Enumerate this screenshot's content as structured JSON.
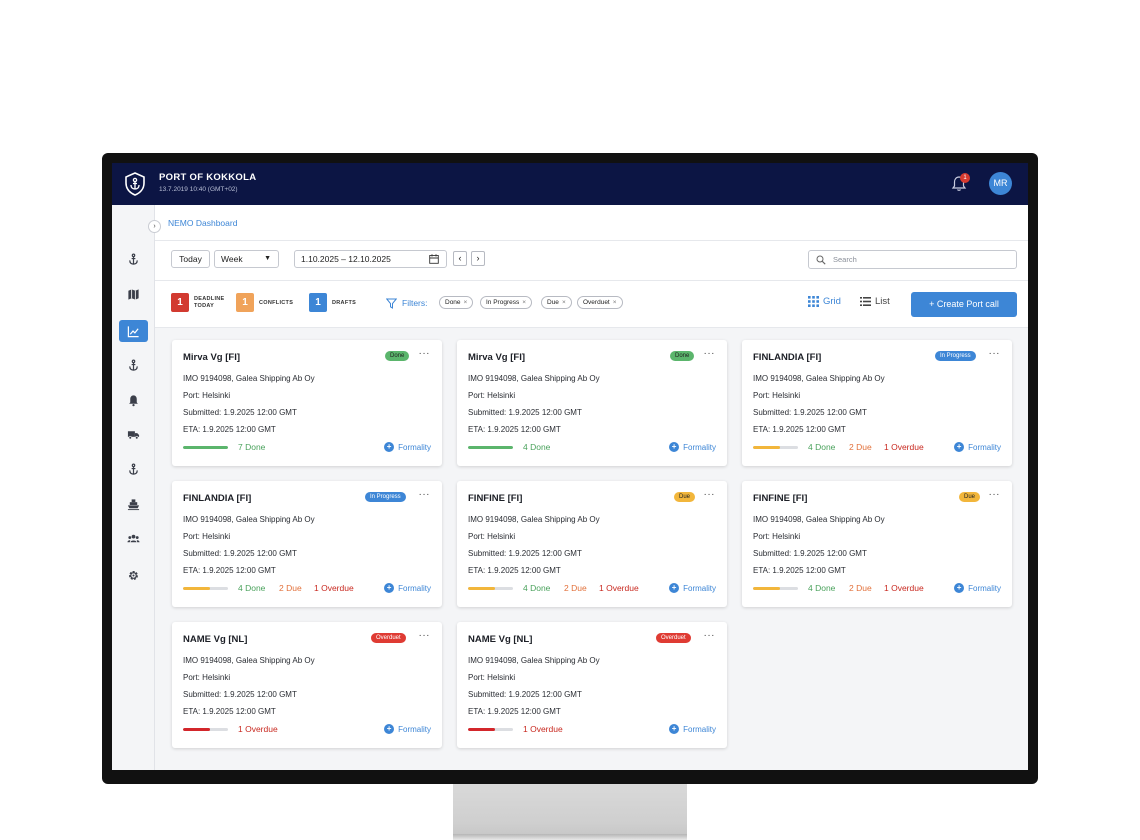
{
  "header": {
    "title": "PORT OF KOKKOLA",
    "datetime": "13.7.2019 10:40 (GMT+02)",
    "notifications": "1",
    "avatar_initials": "MR"
  },
  "breadcrumb": "NEMO Dashboard",
  "toolbar": {
    "today_label": "Today",
    "period_value": "Week",
    "date_range": "1.10.2025  –  12.10.2025",
    "search_placeholder": "Search"
  },
  "status": {
    "deadline_count": "1",
    "deadline_label_1": "DEADLINE",
    "deadline_label_2": "TODAY",
    "conflicts_count": "1",
    "conflicts_label": "CONFLICTS",
    "drafts_count": "1",
    "drafts_label": "DRAFTS",
    "filters_label": "Filters:",
    "filters": [
      "Done",
      "In Progress",
      "Due",
      "Overduet"
    ],
    "view_grid": "Grid",
    "view_list": "List",
    "create_label": "+  Create Port call"
  },
  "colors": {
    "accent": "#3d86d6",
    "topbar": "#0c1544",
    "done": "#5bb56c",
    "due": "#f2b63b",
    "overdue": "#df3b33",
    "deadline": "#d23a30",
    "conflicts": "#f0a35a"
  },
  "cards": [
    {
      "title": "Mirva Vg [FI]",
      "status": "Done",
      "imo": "IMO 9194098,  Galea Shipping Ab Oy",
      "port": "Port:  Helsinki",
      "submitted": "Submitted: 1.9.2025 12:00 GMT",
      "eta": "ETA: 1.9.2025 12:00 GMT",
      "done": "7 Done",
      "due": "",
      "overdue": "",
      "progress": 1.0,
      "progress_color": "#5bb56c",
      "formality": "Formality"
    },
    {
      "title": "Mirva Vg [FI]",
      "status": "Done",
      "imo": "IMO 9194098,  Galea Shipping Ab Oy",
      "port": "Port:  Helsinki",
      "submitted": "Submitted: 1.9.2025 12:00 GMT",
      "eta": "ETA: 1.9.2025 12:00 GMT",
      "done": "4 Done",
      "due": "",
      "overdue": "",
      "progress": 1.0,
      "progress_color": "#5bb56c",
      "formality": "Formality"
    },
    {
      "title": "FINLANDIA [FI]",
      "status": "In Progress",
      "imo": "IMO 9194098,  Galea Shipping Ab Oy",
      "port": "Port:  Helsinki",
      "submitted": "Submitted: 1.9.2025 12:00 GMT",
      "eta": "ETA: 1.9.2025 12:00 GMT",
      "done": "4 Done",
      "due": "2 Due",
      "overdue": "1 Overdue",
      "progress": 0.6,
      "progress_color": "#f2b63b",
      "formality": "Formality"
    },
    {
      "title": "FINLANDIA [FI]",
      "status": "In Progress",
      "imo": "IMO 9194098,  Galea Shipping Ab Oy",
      "port": "Port:  Helsinki",
      "submitted": "Submitted: 1.9.2025 12:00 GMT",
      "eta": "ETA: 1.9.2025 12:00 GMT",
      "done": "4 Done",
      "due": "2 Due",
      "overdue": "1 Overdue",
      "progress": 0.6,
      "progress_color": "#f2b63b",
      "formality": "Formality"
    },
    {
      "title": "FINFINE [FI]",
      "status": "Due",
      "imo": "IMO 9194098,  Galea Shipping Ab Oy",
      "port": "Port:  Helsinki",
      "submitted": "Submitted: 1.9.2025 12:00 GMT",
      "eta": "ETA: 1.9.2025 12:00 GMT",
      "done": "4 Done",
      "due": "2 Due",
      "overdue": "1 Overdue",
      "progress": 0.6,
      "progress_color": "#f2b63b",
      "formality": "Formality"
    },
    {
      "title": "FINFINE [FI]",
      "status": "Due",
      "imo": "IMO 9194098,  Galea Shipping Ab Oy",
      "port": "Port:  Helsinki",
      "submitted": "Submitted: 1.9.2025 12:00 GMT",
      "eta": "ETA: 1.9.2025 12:00 GMT",
      "done": "4 Done",
      "due": "2 Due",
      "overdue": "1 Overdue",
      "progress": 0.6,
      "progress_color": "#f2b63b",
      "formality": "Formality"
    },
    {
      "title": "NAME Vg [NL]",
      "status": "Overduet",
      "imo": "IMO 9194098,  Galea Shipping Ab Oy",
      "port": "Port:  Helsinki",
      "submitted": "Submitted: 1.9.2025 12:00 GMT",
      "eta": "ETA: 1.9.2025 12:00 GMT",
      "done": "",
      "due": "",
      "overdue": "1 Overdue",
      "progress": 0.6,
      "progress_color": "#d3262b",
      "formality": "Formality"
    },
    {
      "title": "NAME Vg [NL]",
      "status": "Overduet",
      "imo": "IMO 9194098,  Galea Shipping Ab Oy",
      "port": "Port:  Helsinki",
      "submitted": "Submitted: 1.9.2025 12:00 GMT",
      "eta": "ETA: 1.9.2025 12:00 GMT",
      "done": "",
      "due": "",
      "overdue": "1 Overdue",
      "progress": 0.6,
      "progress_color": "#d3262b",
      "formality": "Formality"
    }
  ]
}
